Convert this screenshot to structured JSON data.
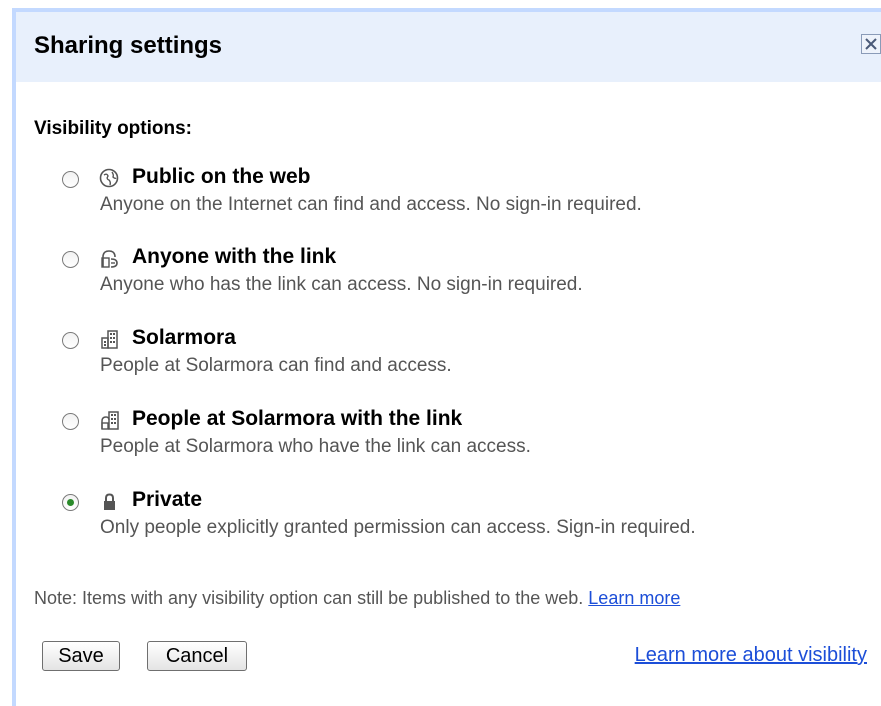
{
  "dialog": {
    "title": "Sharing settings",
    "close_icon": "close-x-icon"
  },
  "visibility": {
    "label": "Visibility options:",
    "options": [
      {
        "icon": "globe-icon",
        "title": "Public on the web",
        "description": "Anyone on the Internet can find and access. No sign-in required.",
        "selected": false
      },
      {
        "icon": "link-person-icon",
        "title": "Anyone with the link",
        "description": "Anyone who has the link can access. No sign-in required.",
        "selected": false
      },
      {
        "icon": "building-icon",
        "title": "Solarmora",
        "description": "People at Solarmora can find and access.",
        "selected": false
      },
      {
        "icon": "building-link-icon",
        "title": "People at Solarmora with the link",
        "description": "People at Solarmora who have the link can access.",
        "selected": false
      },
      {
        "icon": "lock-icon",
        "title": "Private",
        "description": "Only people explicitly granted permission can access. Sign-in required.",
        "selected": true
      }
    ]
  },
  "note": {
    "text": "Note: Items with any visibility option can still be published to the web.",
    "link": "Learn more"
  },
  "actions": {
    "save_label": "Save",
    "cancel_label": "Cancel",
    "learn_more_visibility": "Learn more about visibility"
  },
  "colors": {
    "titlebar_bg": "#e8f0fc",
    "frame_border": "#c3d9ff",
    "link": "#1c4ed8",
    "radio_selected": "#2a8a2a"
  }
}
